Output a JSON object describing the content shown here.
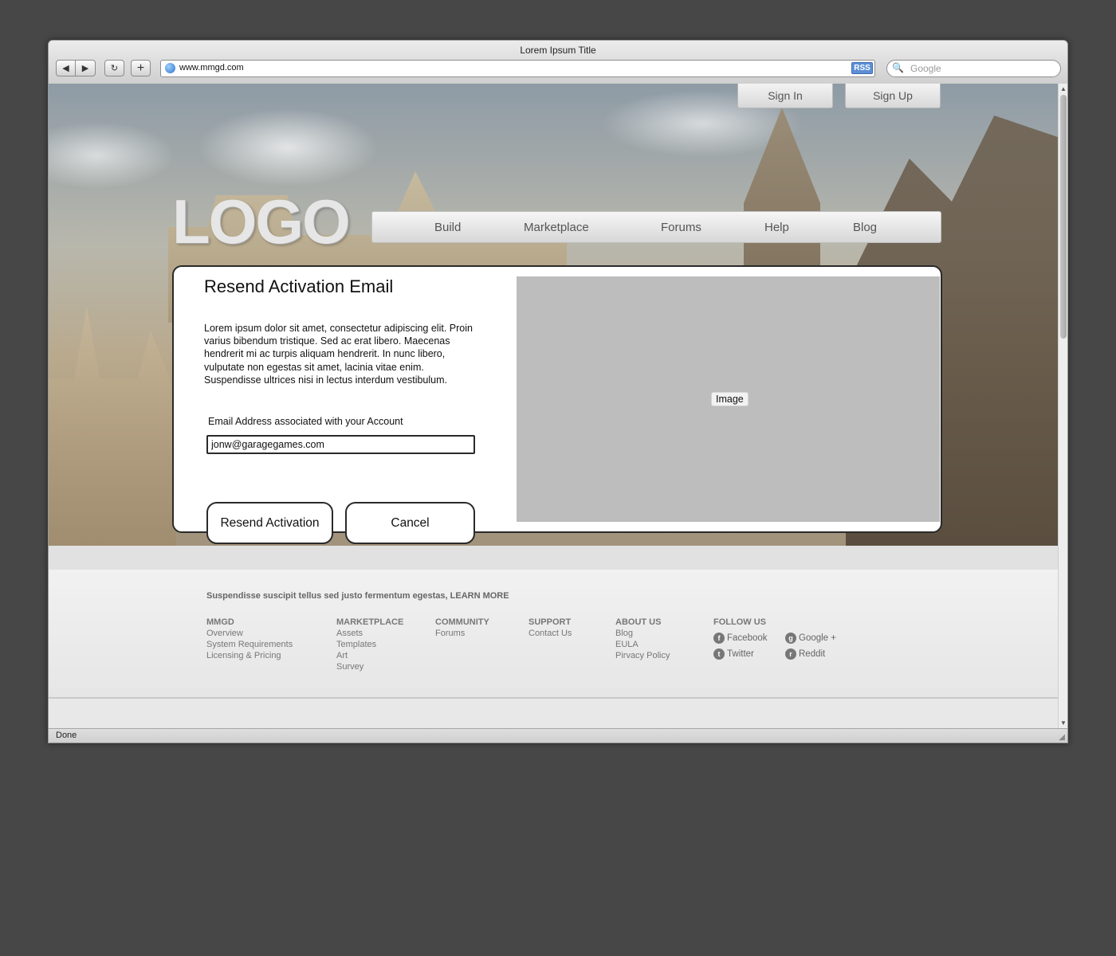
{
  "browser": {
    "window_title": "Lorem Ipsum Title",
    "url": "www.mmgd.com",
    "rss_label": "RSS",
    "search_placeholder": "Google",
    "back_icon": "◀",
    "forward_icon": "▶",
    "reload_icon": "↻",
    "newtab_icon": "+",
    "status": "Done"
  },
  "header": {
    "logo": "LOGO",
    "sign_in": "Sign In",
    "sign_up": "Sign Up",
    "nav": [
      "Build",
      "Marketplace",
      "Forums",
      "Help",
      "Blog"
    ]
  },
  "card": {
    "title": "Resend Activation Email",
    "body": "Lorem ipsum dolor sit amet, consectetur adipiscing elit. Proin varius bibendum tristique. Sed ac erat libero. Maecenas hendrerit mi ac turpis aliquam hendrerit. In nunc libero, vulputate non egestas sit amet, lacinia vitae enim. Suspendisse ultrices nisi in lectus interdum vestibulum.",
    "email_label": "Email Address associated with your Account",
    "email_value": "jonw@garagegames.com",
    "image_label": "Image",
    "resend_button": "Resend Activation",
    "cancel_button": "Cancel"
  },
  "footer": {
    "tagline": "Suspendisse suscipit tellus sed justo fermentum egestas, LEARN MORE",
    "columns": [
      {
        "heading": "MMGD",
        "links": [
          "Overview",
          "System Requirements",
          "Licensing & Pricing"
        ]
      },
      {
        "heading": "MARKETPLACE",
        "links": [
          "Assets",
          "Templates",
          "Art",
          "Survey"
        ]
      },
      {
        "heading": "COMMUNITY",
        "links": [
          "Forums"
        ]
      },
      {
        "heading": "SUPPORT",
        "links": [
          "Contact Us"
        ]
      },
      {
        "heading": "ABOUT US",
        "links": [
          "Blog",
          "EULA",
          "Pirvacy Policy"
        ]
      }
    ],
    "follow_heading": "FOLLOW US",
    "social": {
      "facebook": "Facebook",
      "google_plus": "Google +",
      "twitter": "Twitter",
      "reddit": "Reddit"
    }
  }
}
